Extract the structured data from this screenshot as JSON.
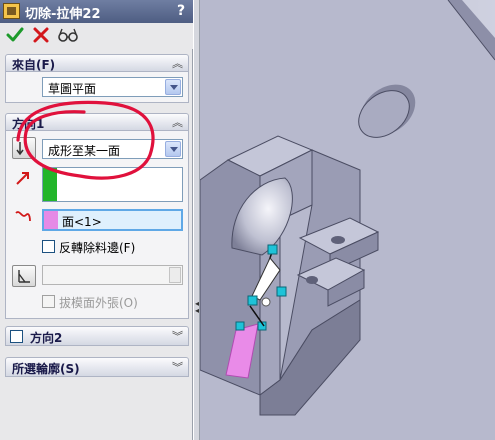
{
  "panel": {
    "title": "切除-拉伸22",
    "help_label": "?",
    "toolbar": {
      "ok_icon": "checkmark-icon",
      "cancel_icon": "x-icon",
      "preview_icon": "eyeglasses-icon"
    },
    "from_group": {
      "title": "來自(F)",
      "start_condition": "草圖平面"
    },
    "direction1_group": {
      "title": "方向1",
      "end_condition": "成形至某一面",
      "face_selection": "面<1>",
      "flip_side_label": "反轉除料邊(F)",
      "flip_side_checked": false,
      "draft_outward_label": "拔模面外張(O)",
      "draft_outward_checked": false,
      "draft_outward_enabled": false
    },
    "direction2_group": {
      "title": "方向2",
      "checked": false
    },
    "selected_contours_group": {
      "title": "所選輪廓(S)"
    }
  },
  "colors": {
    "title_bar": "#5a6a90",
    "direction_indicator": "#22b52a",
    "face_indicator": "#e58ae6",
    "annotation": "#e0113c",
    "model_body": "#aeb0c8",
    "viewport_bg": "#c8cadb"
  }
}
